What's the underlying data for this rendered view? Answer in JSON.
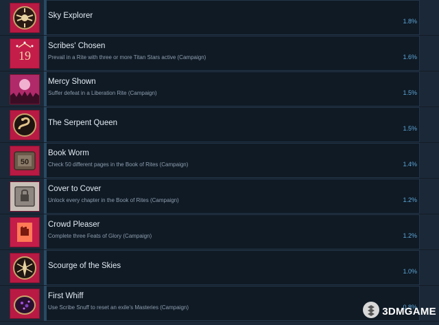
{
  "achievements": [
    {
      "title": "Sky Explorer",
      "description": "",
      "percent": "1.8%",
      "icon": "winged-emblem-icon"
    },
    {
      "title": "Scribes' Chosen",
      "description": "Prevail in a Rite with three or more Titan Stars active (Campaign)",
      "percent": "1.6%",
      "icon": "titan-stars-icon"
    },
    {
      "title": "Mercy Shown",
      "description": "Suffer defeat in a Liberation Rite (Campaign)",
      "percent": "1.5%",
      "icon": "moon-crowd-icon"
    },
    {
      "title": "The Serpent Queen",
      "description": "",
      "percent": "1.5%",
      "icon": "serpent-icon"
    },
    {
      "title": "Book Worm",
      "description": "Check 50 different pages in the Book of Rites (Campaign)",
      "percent": "1.4%",
      "icon": "book-50-icon"
    },
    {
      "title": "Cover to Cover",
      "description": "Unlock every chapter in the Book of Rites (Campaign)",
      "percent": "1.2%",
      "icon": "locked-book-icon"
    },
    {
      "title": "Crowd Pleaser",
      "description": "Complete three Feats of Glory (Campaign)",
      "percent": "1.2%",
      "icon": "raised-fist-icon"
    },
    {
      "title": "Scourge of the Skies",
      "description": "",
      "percent": "1.0%",
      "icon": "sky-sigil-icon"
    },
    {
      "title": "First Whiff",
      "description": "Use Scribe Snuff to reset an exile's Masteries (Campaign)",
      "percent": "0.8%",
      "icon": "snuff-box-icon"
    }
  ],
  "watermark": {
    "text": "3DMGAME",
    "icon": "3dm-logo-icon"
  },
  "colors": {
    "icon_bg": "#c41d4a",
    "percent": "#5fa7d7",
    "background": "#1b2838"
  }
}
